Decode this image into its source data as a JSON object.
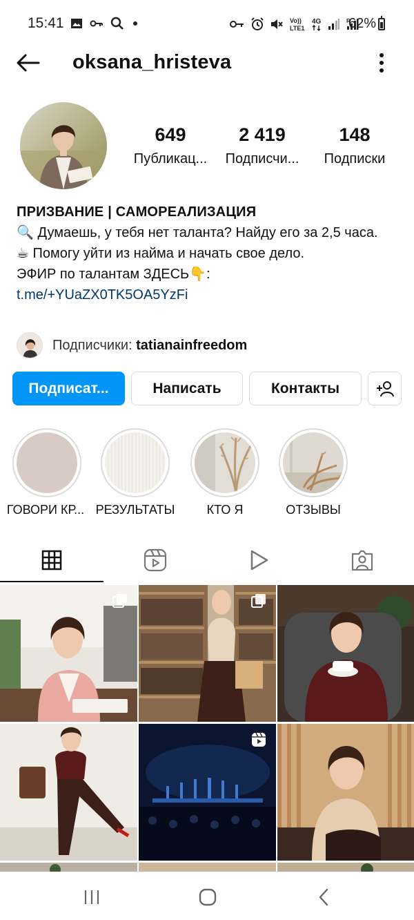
{
  "status_bar": {
    "time": "15:41",
    "battery": "62%",
    "left_icons": [
      "gallery-icon",
      "key-icon",
      "search-icon",
      "dot-icon"
    ],
    "right_icons": [
      "vpn-key-icon",
      "alarm-icon",
      "mute-icon",
      "volte-icon",
      "4g-icon",
      "signal-icon",
      "signal-r-icon"
    ]
  },
  "header": {
    "username": "oksana_hristeva"
  },
  "stats": [
    {
      "value": "649",
      "label": "Публикац..."
    },
    {
      "value": "2 419",
      "label": "Подписчи..."
    },
    {
      "value": "148",
      "label": "Подписки"
    }
  ],
  "bio": {
    "title": "ПРИЗВАНИЕ | САМОРЕАЛИЗАЦИЯ",
    "line1": "🔍 Думаешь, у тебя нет таланта? Найду его за 2,5 часа.",
    "line2": "☕ Помогу уйти из найма и начать свое дело.",
    "line3": "ЭФИР по талантам ЗДЕСЬ👇:",
    "link": "t.me/+YUaZX0TK5OA5YzFi"
  },
  "followed_by": {
    "prefix": "Подписчики:",
    "name": "tatianainfreedom"
  },
  "buttons": {
    "follow": "Подписат...",
    "message": "Написать",
    "contacts": "Контакты"
  },
  "highlights": [
    {
      "label": "ГОВОРИ КР..."
    },
    {
      "label": "РЕЗУЛЬТАТЫ"
    },
    {
      "label": "КТО Я"
    },
    {
      "label": "ОТЗЫВЫ"
    }
  ],
  "tabs": [
    "grid-icon",
    "reels-icon",
    "play-icon",
    "tagged-icon"
  ],
  "colors": {
    "accent": "#0095f6",
    "link": "#00376b"
  }
}
